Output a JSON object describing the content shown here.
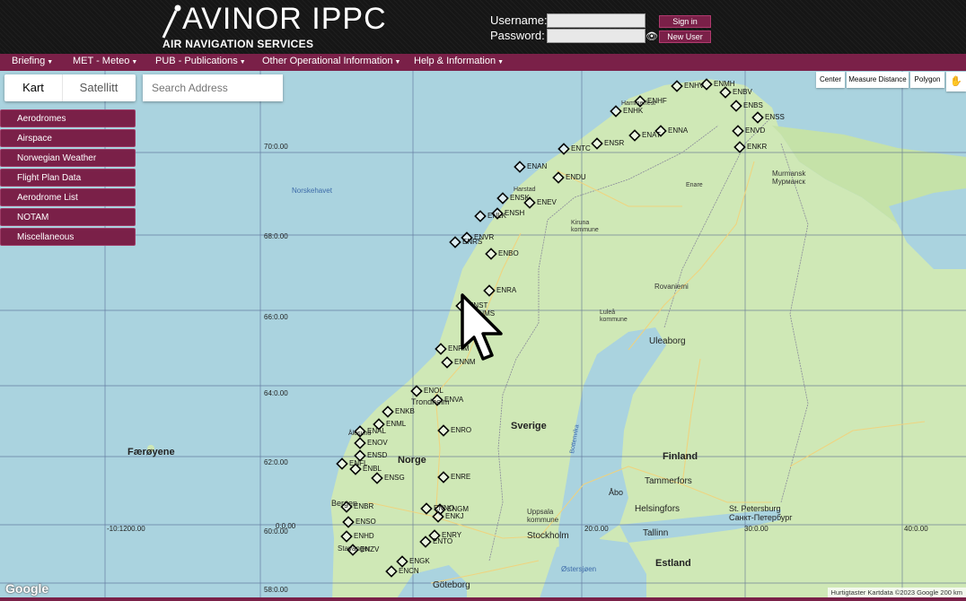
{
  "header": {
    "logo_title": "AVINOR IPPC",
    "logo_subtitle": "AIR NAVIGATION SERVICES",
    "username_label": "Username:",
    "password_label": "Password:",
    "sign_in_label": "Sign in",
    "new_user_label": "New User",
    "username_value": "",
    "password_value": ""
  },
  "nav": {
    "items": [
      {
        "label": "Briefing"
      },
      {
        "label": "MET - Meteo"
      },
      {
        "label": "PUB - Publications"
      },
      {
        "label": "Other Operational Information"
      },
      {
        "label": "Help & Information"
      }
    ]
  },
  "map_controls": {
    "kart_label": "Kart",
    "satellitt_label": "Satellitt",
    "search_placeholder": "Search Address",
    "center_label": "Center",
    "measure_label": "Measure Distance",
    "polygon_label": "Polygon"
  },
  "side_menu": {
    "items": [
      {
        "label": "Aerodromes"
      },
      {
        "label": "Airspace"
      },
      {
        "label": "Norwegian Weather"
      },
      {
        "label": "Flight Plan Data"
      },
      {
        "label": "Aerodrome List"
      },
      {
        "label": "NOTAM"
      },
      {
        "label": "Miscellaneous"
      }
    ]
  },
  "grid_labels": {
    "lat70": "70:0.00",
    "lat68": "68:0.00",
    "lat66": "66:0.00",
    "lat64": "64:0.00",
    "lat62": "62:0.00",
    "lat60": "60:0.00",
    "lat58": "58:0.00",
    "lon_left": "-10:1200.00",
    "lon0": "0:0.00",
    "lon20": "20:0.00",
    "lon30": "30:0.00",
    "lon40": "40:0.00"
  },
  "places": {
    "norskehavet": "Norskehavet",
    "faroyene": "Færøyene",
    "norge": "Norge",
    "sverige": "Sverige",
    "finland": "Finland",
    "tammerfors": "Tammerfors",
    "helsingfors": "Helsingfors",
    "abo": "Åbo",
    "tallinn": "Tallinn",
    "estland": "Estland",
    "stockholm": "Stockholm",
    "uppsala": "Uppsala kommune",
    "goteborg": "Göteborg",
    "uleaborg": "Uleaborg",
    "rovaniemi": "Rovaniemi",
    "lulea": "Luleå kommune",
    "kiruna": "Kiruna kommune",
    "murmansk": "Murmansk Мурманск",
    "stpete": "St. Petersburg Санкт-Петербург",
    "enare": "Enare",
    "bergen": "Bergen",
    "trondheim": "Trondheim",
    "harstad": "Harstad",
    "hammerfest": "Hammerfest",
    "stavanger": "Stavanger",
    "alesund": "Ålesund",
    "bottenvika": "Bottenvika",
    "ostersjon": "Østersjøen"
  },
  "aerodromes": [
    {
      "code": "ENHV"
    },
    {
      "code": "ENMH"
    },
    {
      "code": "ENBV"
    },
    {
      "code": "ENHF"
    },
    {
      "code": "ENHK"
    },
    {
      "code": "ENBS"
    },
    {
      "code": "ENSS"
    },
    {
      "code": "ENNA"
    },
    {
      "code": "ENAT"
    },
    {
      "code": "ENVD"
    },
    {
      "code": "ENKR"
    },
    {
      "code": "ENSR"
    },
    {
      "code": "ENTC"
    },
    {
      "code": "ENAN"
    },
    {
      "code": "ENDU"
    },
    {
      "code": "ENSK"
    },
    {
      "code": "ENEV"
    },
    {
      "code": "ENSH"
    },
    {
      "code": "ENLK"
    },
    {
      "code": "ENVR"
    },
    {
      "code": "ENRS"
    },
    {
      "code": "ENBO"
    },
    {
      "code": "ENRA"
    },
    {
      "code": "ENST"
    },
    {
      "code": "ENMS"
    },
    {
      "code": "ENRM"
    },
    {
      "code": "ENNM"
    },
    {
      "code": "ENOL"
    },
    {
      "code": "ENVA"
    },
    {
      "code": "ENKB"
    },
    {
      "code": "ENML"
    },
    {
      "code": "ENAL"
    },
    {
      "code": "ENOV"
    },
    {
      "code": "ENSD"
    },
    {
      "code": "ENFL"
    },
    {
      "code": "ENBL"
    },
    {
      "code": "ENSG"
    },
    {
      "code": "ENRO"
    },
    {
      "code": "ENRE"
    },
    {
      "code": "ENBR"
    },
    {
      "code": "ENGM"
    },
    {
      "code": "ENKJ"
    },
    {
      "code": "ENSO"
    },
    {
      "code": "ENHD"
    },
    {
      "code": "ENZV"
    },
    {
      "code": "ENRY"
    },
    {
      "code": "ENTO"
    },
    {
      "code": "ENGK"
    },
    {
      "code": "ENCN"
    },
    {
      "code": "ENNO"
    }
  ],
  "footer": {
    "google": "Google",
    "attribution": "Hurtigtaster   Kartdata ©2023 Google   200 km"
  },
  "colors": {
    "brand": "#7a2048",
    "water": "#aad3df",
    "land": "#c8e6b0",
    "header_bg": "#161616"
  }
}
